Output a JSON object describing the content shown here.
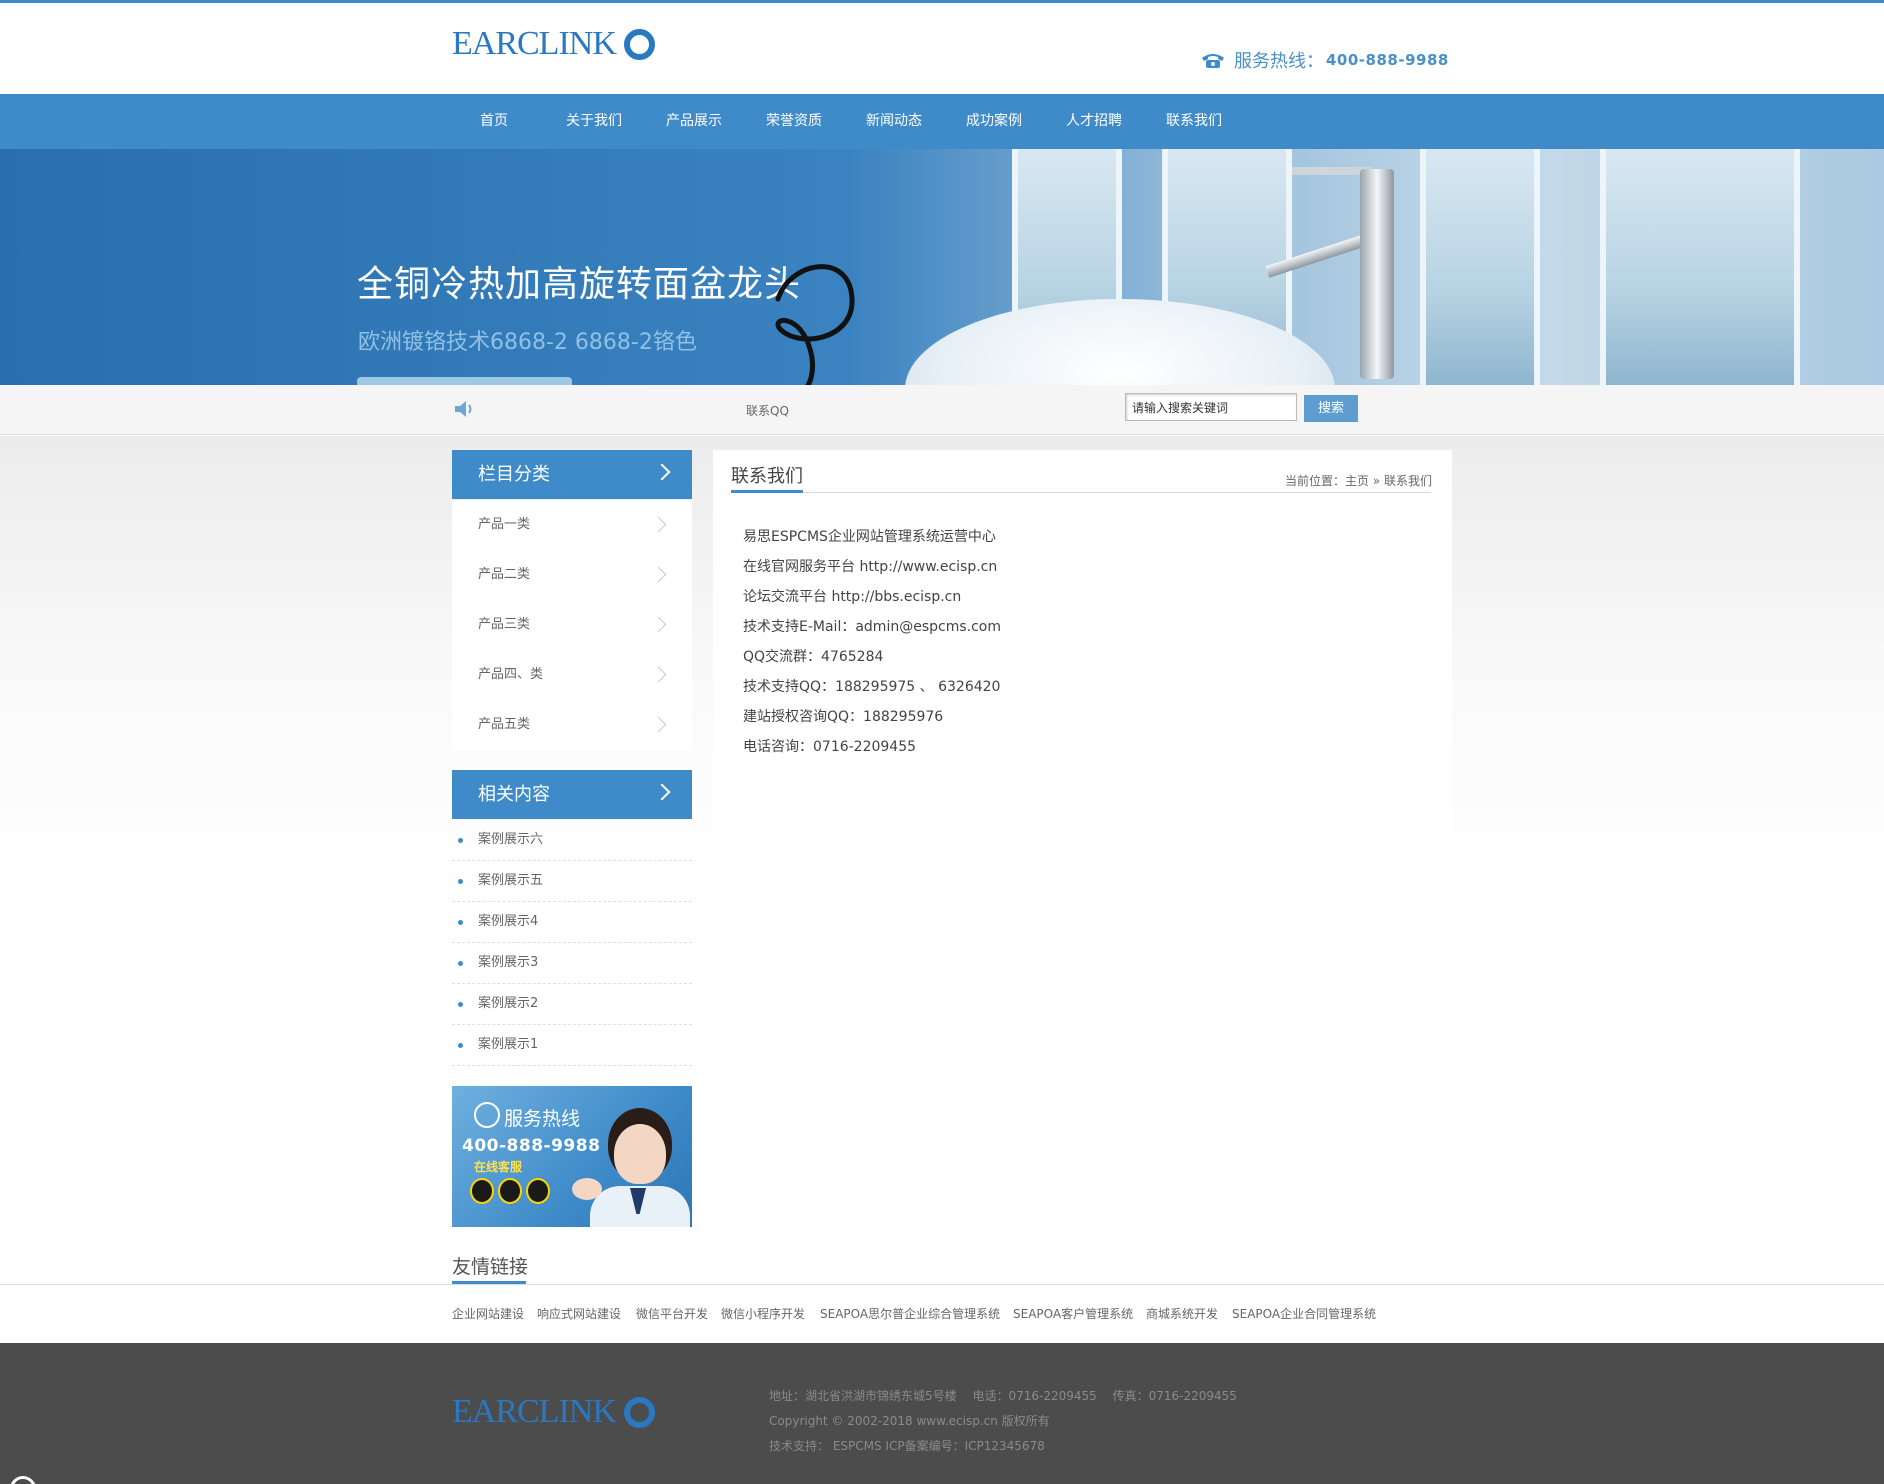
{
  "brand": {
    "logo_text": "EARCLINK",
    "accent": "#3f8bc9",
    "logo_color": "#2a78c2"
  },
  "header": {
    "phone_icon": "phone-icon",
    "hotline_label": "服务热线：",
    "hotline_number": "400-888-9988"
  },
  "nav": {
    "items": [
      {
        "label": "首页"
      },
      {
        "label": "关于我们"
      },
      {
        "label": "产品展示"
      },
      {
        "label": "荣誉资质"
      },
      {
        "label": "新闻动态"
      },
      {
        "label": "成功案例"
      },
      {
        "label": "人才招聘"
      },
      {
        "label": "联系我们"
      }
    ]
  },
  "banner": {
    "title": "全铜冷热加高旋转面盆龙头",
    "subtitle": "欧洲镀铬技术6868-2 6868-2铬色"
  },
  "infobar": {
    "speaker_icon": "speaker-icon",
    "qq_text": "联系QQ",
    "search_placeholder": "请输入搜索关键词",
    "search_button": "搜索"
  },
  "sidebar": {
    "category_title": "栏目分类",
    "categories": [
      {
        "label": "产品一类"
      },
      {
        "label": "产品二类"
      },
      {
        "label": "产品三类"
      },
      {
        "label": "产品四、类"
      },
      {
        "label": "产品五类"
      }
    ],
    "related_title": "相关内容",
    "related": [
      {
        "label": "案例展示六"
      },
      {
        "label": "案例展示五"
      },
      {
        "label": "案例展示4"
      },
      {
        "label": "案例展示3"
      },
      {
        "label": "案例展示2"
      },
      {
        "label": "案例展示1"
      }
    ],
    "promo": {
      "title": "服务热线",
      "number": "400-888-9988",
      "online": "在线客服"
    }
  },
  "main": {
    "title": "联系我们",
    "breadcrumb": "当前位置：主页 » 联系我们",
    "lines": [
      "易思ESPCMS企业网站管理系统运营中心",
      "在线官网服务平台 http://www.ecisp.cn",
      "论坛交流平台 http://bbs.ecisp.cn",
      "技术支持E-Mail：admin@espcms.com",
      "QQ交流群：4765284",
      "技术支持QQ：188295975 、 6326420",
      "建站授权咨询QQ：188295976",
      "电话咨询：0716-2209455"
    ]
  },
  "links": {
    "title": "友情链接",
    "items": [
      "企业网站建设",
      "响应式网站建设",
      "微信平台开发",
      "微信小程序开发",
      "SEAPOA思尔普企业综合管理系统",
      "SEAPOA客户管理系统",
      "商城系统开发",
      "SEAPOA企业合同管理系统"
    ]
  },
  "footer": {
    "address": "地址：湖北省洪湖市锦绣东城5号楼　 电话：0716-2209455　 传真：0716-2209455",
    "copyright": "Copyright © 2002-2018 www.ecisp.cn 版权所有",
    "support": "技术支持： ESPCMS ICP备案编号：ICP12345678"
  }
}
